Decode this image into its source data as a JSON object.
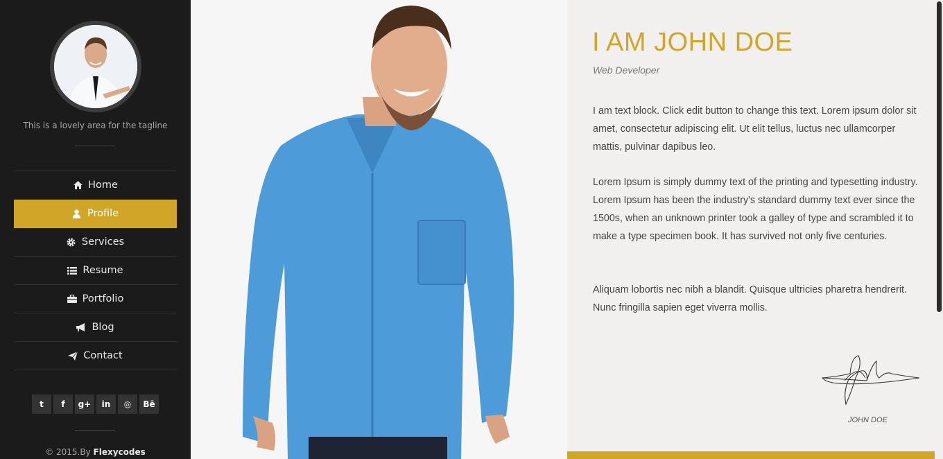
{
  "sidebar": {
    "tagline": "This is a lovely area for the tagline",
    "nav": [
      {
        "label": "Home",
        "icon": "home-icon"
      },
      {
        "label": "Profile",
        "icon": "user-icon",
        "active": true
      },
      {
        "label": "Services",
        "icon": "gear-icon"
      },
      {
        "label": "Resume",
        "icon": "list-icon"
      },
      {
        "label": "Portfolio",
        "icon": "briefcase-icon"
      },
      {
        "label": "Blog",
        "icon": "megaphone-icon"
      },
      {
        "label": "Contact",
        "icon": "paper-plane-icon"
      }
    ],
    "social": [
      {
        "glyph": "t",
        "icon": "twitter-icon"
      },
      {
        "glyph": "f",
        "icon": "facebook-icon"
      },
      {
        "glyph": "g+",
        "icon": "google-plus-icon"
      },
      {
        "glyph": "in",
        "icon": "linkedin-icon"
      },
      {
        "glyph": "◎",
        "icon": "dribbble-icon"
      },
      {
        "glyph": "Bē",
        "icon": "behance-icon"
      }
    ],
    "copyright_prefix": "© 2015.By",
    "copyright_brand": "Flexycodes"
  },
  "profile": {
    "title": "I AM JOHN DOE",
    "subtitle": "Web Developer",
    "paragraphs": [
      "I am text block. Click edit button to change this text. Lorem ipsum dolor sit amet, consectetur adipiscing elit. Ut elit tellus, luctus nec ullamcorper mattis, pulvinar dapibus leo.",
      "Lorem Ipsum is simply dummy text of the printing and typesetting industry. Lorem Ipsum has been the industry's standard dummy text ever since the 1500s, when an unknown printer took a galley of type and scrambled it to make a type specimen book. It has survived not only five centuries.",
      "Aliquam lobortis nec nibh a blandit. Quisque ultricies pharetra hendrerit. Nunc fringilla sapien eget viverra mollis."
    ],
    "signature_name": "JOHN DOE"
  },
  "colors": {
    "accent": "#d0a628",
    "sidebar_bg": "#1b1b1b",
    "content_bg": "#f1f0ee"
  }
}
